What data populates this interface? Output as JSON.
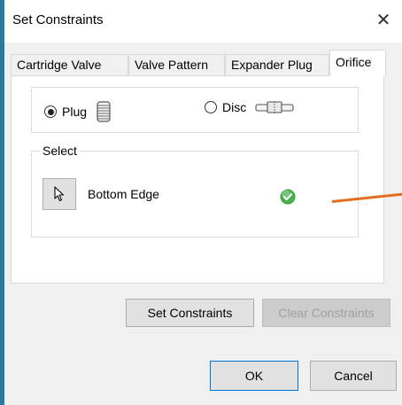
{
  "window": {
    "title": "Set Constraints",
    "close_glyph": "✕"
  },
  "tabs": [
    {
      "label": "Cartridge Valve",
      "active": false
    },
    {
      "label": "Valve Pattern",
      "active": false
    },
    {
      "label": "Expander Plug",
      "active": false
    },
    {
      "label": "Orifice",
      "active": true
    }
  ],
  "type_options": [
    {
      "label": "Plug",
      "selected": true,
      "icon": "threaded-plug-icon"
    },
    {
      "label": "Disc",
      "selected": false,
      "icon": "disc-icon"
    }
  ],
  "select_group": {
    "legend": "Select",
    "selection_label": "Bottom Edge",
    "status_icon": "check-icon",
    "status_color": "#3cb44b"
  },
  "buttons": {
    "set_constraints": "Set Constraints",
    "clear_constraints": "Clear Constraints",
    "ok": "OK",
    "cancel": "Cancel"
  },
  "colors": {
    "accent": "#0078d7",
    "annotation": "#e46c1e",
    "background": "#2b7a9b"
  }
}
